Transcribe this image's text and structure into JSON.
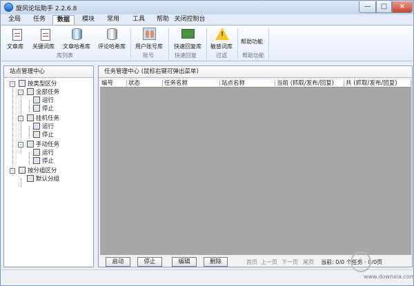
{
  "window": {
    "title": "旋风论坛助手 2.2.6.8",
    "min": "—",
    "max": "□",
    "close": "×"
  },
  "menu": {
    "tabs": [
      "全局",
      "任务",
      "数据",
      "模块",
      "常用",
      "工具",
      "帮助",
      "关闭控制台"
    ]
  },
  "ribbon": {
    "buttons": [
      "文章库",
      "关键词库",
      "文章哈希库",
      "评论哈希库",
      "用户账号库",
      "快速回复库",
      "敏感词库",
      "帮助功能"
    ],
    "groups": [
      "库列表",
      "账号",
      "快速回复",
      "过滤",
      "帮助功能"
    ]
  },
  "left_panel": {
    "title": "站点管理中心",
    "nodes": [
      "按类型区分",
      "全部任务",
      "运行",
      "停止",
      "挂机任务",
      "运行",
      "停止",
      "手动任务",
      "运行",
      "停止",
      "按分组区分",
      "默认分组"
    ]
  },
  "right_panel": {
    "title": "任务管理中心 (鼠标右键可弹出菜单)",
    "columns": [
      "编号",
      "状态",
      "任务名称",
      "站点名称",
      "当前 (抓取/发布/回复)",
      "共 (抓取/发布/回复)"
    ],
    "buttons": [
      "启动",
      "停止",
      "编辑",
      "删除"
    ],
    "pager": [
      "首页",
      "上一页",
      "下一页",
      "尾页"
    ],
    "current_label": "当前: 0/0 个任务 · 0/0页"
  },
  "watermark": {
    "text": "www.downxia.com"
  }
}
